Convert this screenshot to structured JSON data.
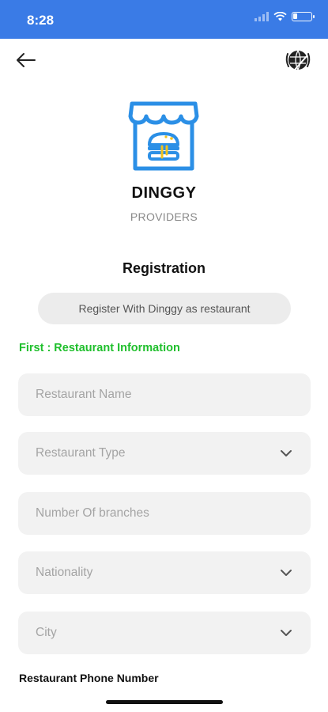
{
  "status": {
    "time": "8:28"
  },
  "brand": {
    "name": "DINGGY",
    "sub": "PROVIDERS"
  },
  "page": {
    "title": "Registration"
  },
  "register_pill": "Register With Dinggy as restaurant",
  "step_label": "First : Restaurant Information",
  "fields": {
    "name": {
      "placeholder": "Restaurant Name"
    },
    "type": {
      "placeholder": "Restaurant Type"
    },
    "branches": {
      "placeholder": "Number Of branches"
    },
    "nationality": {
      "placeholder": "Nationality"
    },
    "city": {
      "placeholder": "City"
    }
  },
  "phone_label": "Restaurant Phone Number",
  "icons": {
    "back": "back-arrow-icon",
    "language": "globe-language-icon",
    "logo": "restaurant-store-logo-icon",
    "dropdown": "chevron-down-icon"
  },
  "colors": {
    "status_bar": "#3a7be6",
    "logo_blue": "#2b8fe6",
    "step_green": "#1fbf2c",
    "field_bg": "#f2f2f2"
  }
}
